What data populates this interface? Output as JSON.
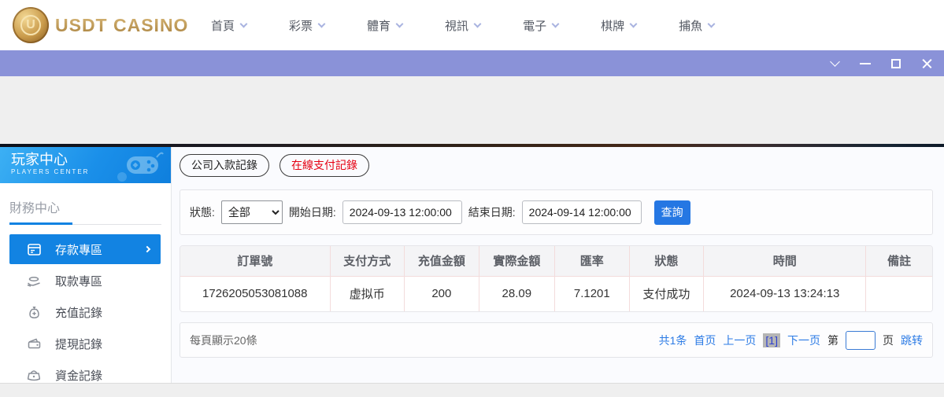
{
  "colors": {
    "accent_blue": "#1283e2",
    "titlebar_purple": "#8a92d8",
    "tab_active_red": "#e60012",
    "link_blue": "#2c7be5",
    "logo_gold": "#c9a45c"
  },
  "icons": {
    "chevron_down": "v-chevron (CSS borders)",
    "minimize": "horizontal bar",
    "maximize": "square outline",
    "close": "x cross",
    "deposit": "card-icon",
    "withdraw": "hand-coins-icon",
    "recharge": "money-bag-icon",
    "cashout": "wallet-icon",
    "funds": "purse-icon",
    "gamepad": "game-controller-icon"
  },
  "topnav": {
    "logo_letter": "U",
    "logo_text": "USDT CASINO",
    "items": [
      "首頁",
      "彩票",
      "體育",
      "視訊",
      "電子",
      "棋牌",
      "捕魚"
    ]
  },
  "sidebar": {
    "title": "玩家中心",
    "subtitle": "PLAYERS CENTER",
    "section": "財務中心",
    "items": [
      {
        "label": "存款專區",
        "active": true
      },
      {
        "label": "取款專區",
        "active": false
      },
      {
        "label": "充值記錄",
        "active": false
      },
      {
        "label": "提現記錄",
        "active": false
      },
      {
        "label": "資金記錄",
        "active": false
      }
    ]
  },
  "tabs": [
    {
      "label": "公司入款記錄",
      "active": false
    },
    {
      "label": "在線支付記錄",
      "active": true
    }
  ],
  "filters": {
    "status_label": "狀態:",
    "status_value": "全部",
    "start_label": "開始日期:",
    "start_value": "2024-09-13 12:00:00",
    "end_label": "結束日期:",
    "end_value": "2024-09-14 12:00:00",
    "search_label": "查詢"
  },
  "table": {
    "headers": [
      "訂單號",
      "支付方式",
      "充值金額",
      "實際金額",
      "匯率",
      "狀態",
      "時間",
      "備註"
    ],
    "rows": [
      [
        "1726205053081088",
        "虚拟币",
        "200",
        "28.09",
        "7.1201",
        "支付成功",
        "2024-09-13 13:24:13",
        ""
      ]
    ]
  },
  "pagination": {
    "per_page": "每頁顯示20條",
    "total": "共1条",
    "first": "首页",
    "prev": "上一页",
    "current": "[1]",
    "next": "下一页",
    "jump_prefix": "第",
    "jump_suffix": "页",
    "jump_action": "跳转",
    "jump_value": ""
  }
}
